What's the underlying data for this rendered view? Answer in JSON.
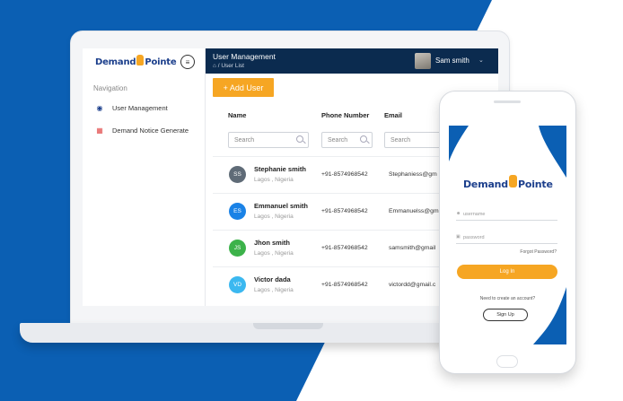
{
  "brand": {
    "logo_left": "Demand",
    "logo_right": "Pointe",
    "accent": "#f6a623",
    "navy": "#0b2b4f",
    "blue": "#0b5fb3"
  },
  "sidebar": {
    "nav_title": "Navigation",
    "items": [
      {
        "label": "User Management",
        "icon": "users-icon"
      },
      {
        "label": "Demand Notice Generate",
        "icon": "document-icon"
      }
    ]
  },
  "header": {
    "title": "User Management",
    "breadcrumb": "⌂ / User List",
    "user_name": "Sam smith",
    "caret": "⌄"
  },
  "toolbar": {
    "add_user_label": "+ Add User"
  },
  "table": {
    "columns": [
      "Name",
      "Phone Number",
      "Email"
    ],
    "search_placeholders": [
      "Search",
      "Search",
      "Search"
    ],
    "rows": [
      {
        "initials": "SS",
        "name": "Stephanie smith",
        "location": "Lagos , Nigeria",
        "phone": "+91-8574968542",
        "email": "Stephaniess@gm",
        "color": "#5f6b77"
      },
      {
        "initials": "ES",
        "name": "Emmanuel smith",
        "location": "Lagos , Nigeria",
        "phone": "+91-8574968542",
        "email": "Emmanuelss@gm",
        "color": "#1a82e6"
      },
      {
        "initials": "JS",
        "name": "Jhon smith",
        "location": "Lagos , Nigeria",
        "phone": "+91-8574968542",
        "email": "samsmith@gmail",
        "color": "#3cb24a"
      },
      {
        "initials": "VD",
        "name": "Victor dada",
        "location": "Lagos , Nigeria",
        "phone": "+91-8574968542",
        "email": "victordd@gmail.c",
        "color": "#3bb8f0"
      }
    ]
  },
  "phone_login": {
    "username_placeholder": "username",
    "password_placeholder": "password",
    "forgot": "Forgot Password?",
    "login_label": "Log In",
    "need_account": "Need to create an account?",
    "signup_label": "Sign Up"
  }
}
